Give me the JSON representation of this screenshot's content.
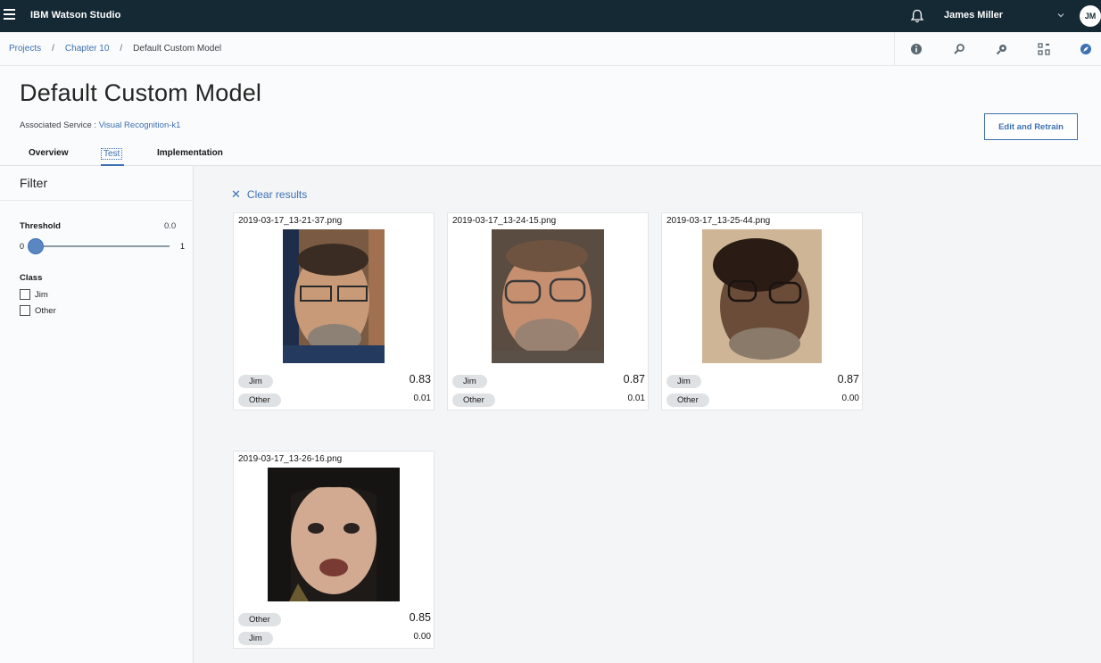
{
  "app": {
    "title": "IBM Watson Studio",
    "user": "James Miller",
    "initials": "JM"
  },
  "breadcrumb": {
    "items": [
      "Projects",
      "Chapter 10"
    ],
    "current": "Default Custom Model",
    "separator": "/"
  },
  "header": {
    "title": "Default Custom Model",
    "assoc_label": "Associated Service : ",
    "assoc_link": "Visual Recognition-k1",
    "edit_button": "Edit and Retrain",
    "tabs": [
      "Overview",
      "Test",
      "Implementation"
    ],
    "active_tab": "Test"
  },
  "filter": {
    "title": "Filter",
    "threshold_label": "Threshold",
    "threshold_value": "0.0",
    "slider_min": "0",
    "slider_max": "1",
    "slider_level": 0,
    "class_label": "Class",
    "classes": [
      "Jim",
      "Other"
    ]
  },
  "results": {
    "clear_label": "Clear results",
    "cards": [
      {
        "file": "2019-03-17_13-21-37.png",
        "rows": [
          {
            "class": "Jim",
            "score": "0.83"
          },
          {
            "class": "Other",
            "score": "0.01"
          }
        ]
      },
      {
        "file": "2019-03-17_13-24-15.png",
        "rows": [
          {
            "class": "Jim",
            "score": "0.87"
          },
          {
            "class": "Other",
            "score": "0.01"
          }
        ]
      },
      {
        "file": "2019-03-17_13-25-44.png",
        "rows": [
          {
            "class": "Jim",
            "score": "0.87"
          },
          {
            "class": "Other",
            "score": "0.00"
          }
        ]
      },
      {
        "file": "2019-03-17_13-26-16.png",
        "rows": [
          {
            "class": "Other",
            "score": "0.85"
          },
          {
            "class": "Jim",
            "score": "0.00"
          }
        ]
      }
    ]
  },
  "colors": {
    "topbar": "#152935",
    "accent": "#3d70b2",
    "tag": "#dfe2e4"
  },
  "icons": [
    "menu-icon",
    "notification-bell-icon",
    "chevron-down-icon",
    "info-icon",
    "find-icon",
    "magic-icon",
    "grid-icon",
    "compass-icon",
    "close-icon",
    "photo"
  ]
}
